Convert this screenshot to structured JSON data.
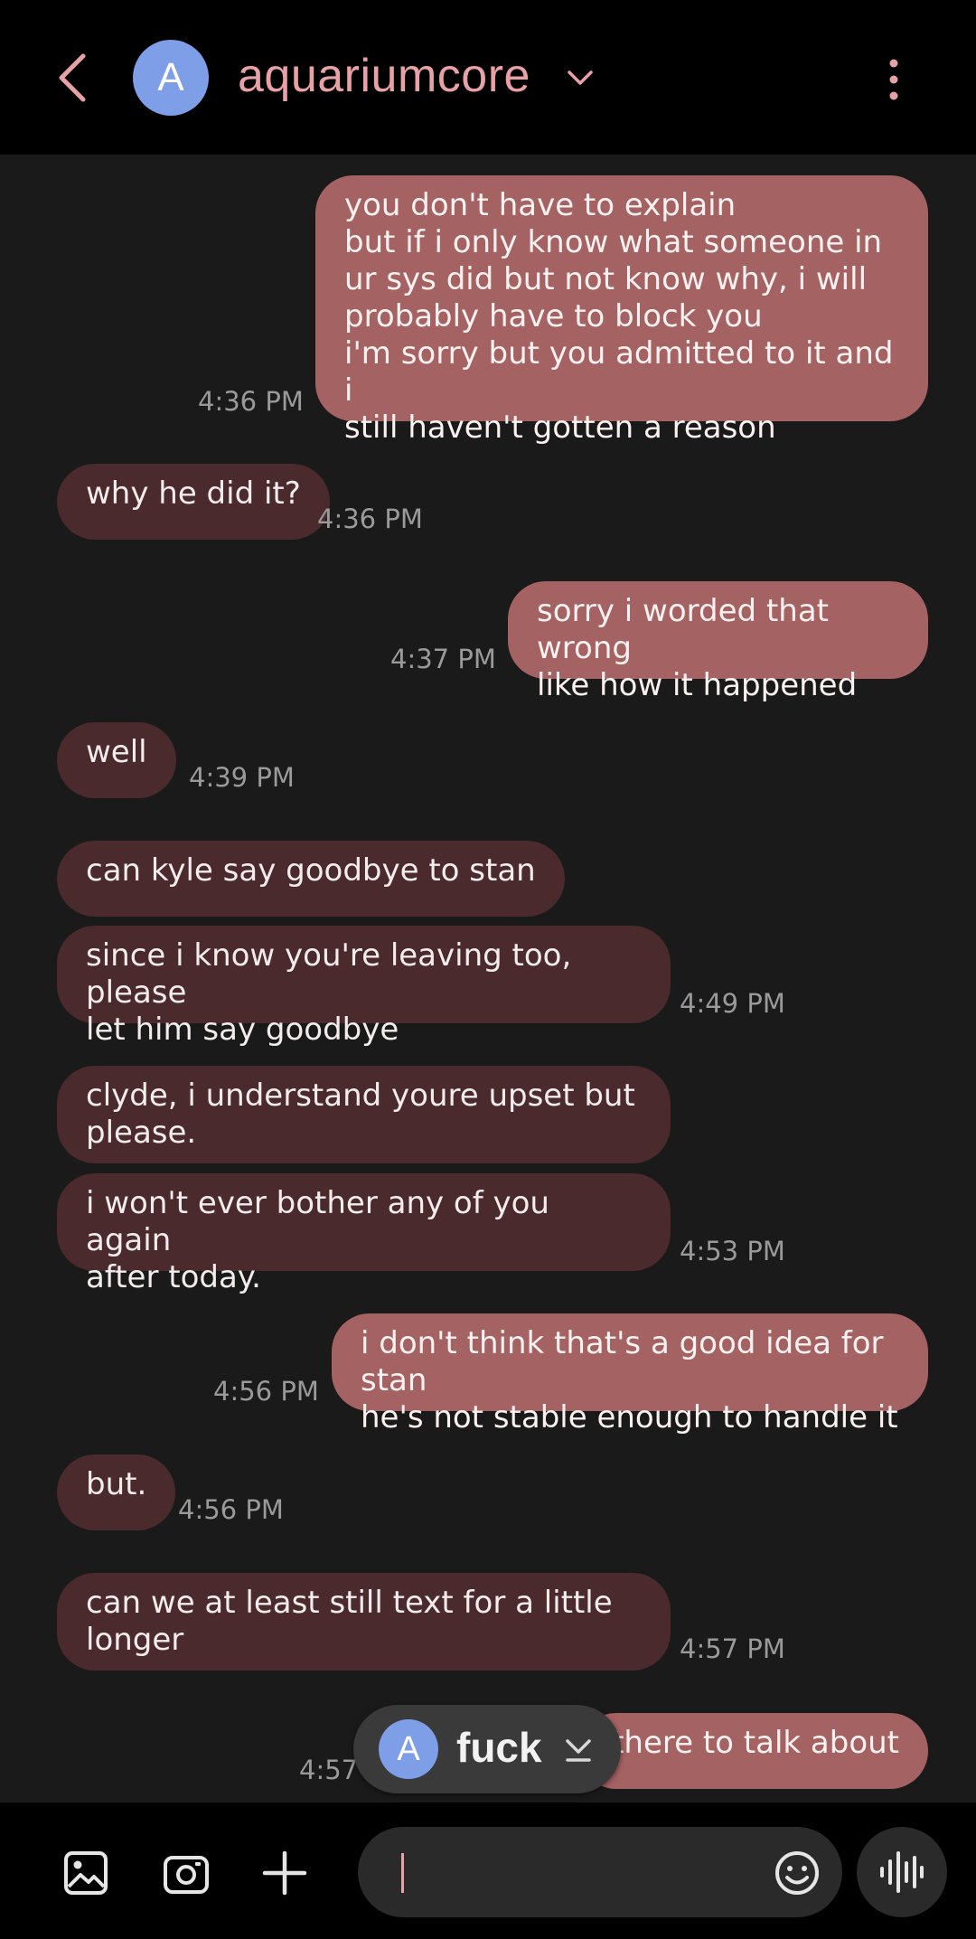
{
  "header": {
    "avatar_letter": "A",
    "contact_name": "aquariumcore"
  },
  "messages": [
    {
      "dir": "sent",
      "text": "you don't have to explain\nbut if i only know what someone in\nur sys did but not know why, i will\nprobably have to block you\ni'm sorry but you admitted to it and i\nstill haven't gotten a reason",
      "time": "4:36 PM"
    },
    {
      "dir": "recv",
      "text": "why he did it?",
      "time": "4:36 PM"
    },
    {
      "dir": "sent",
      "text": "sorry i worded that wrong\nlike how it happened",
      "time": "4:37 PM"
    },
    {
      "dir": "recv",
      "text": "well",
      "time": "4:39 PM"
    },
    {
      "dir": "recv",
      "text": "can kyle say goodbye to stan",
      "time": ""
    },
    {
      "dir": "recv",
      "text": "since i know you're leaving too, please\nlet him say goodbye",
      "time": "4:49 PM"
    },
    {
      "dir": "recv",
      "text": "clyde, i understand youre upset but\nplease.",
      "time": ""
    },
    {
      "dir": "recv",
      "text": "i won't ever bother any of you again\nafter today.",
      "time": "4:53 PM"
    },
    {
      "dir": "sent",
      "text": "i don't think that's a good idea for stan\nhe's not stable enough to handle it",
      "time": "4:56 PM"
    },
    {
      "dir": "recv",
      "text": "but.",
      "time": "4:56 PM"
    },
    {
      "dir": "recv",
      "text": "can we at least still text for a little\nlonger",
      "time": "4:57 PM"
    },
    {
      "dir": "sent",
      "text": "there to talk about",
      "time": "4:57"
    }
  ],
  "floating_chip": {
    "avatar_letter": "A",
    "label": "fuck"
  },
  "composer": {
    "value": ""
  },
  "colors": {
    "sent_bubble": "#a56263",
    "recv_bubble": "#4a2a2d",
    "accent": "#e8a1a5",
    "avatar": "#7f9ee8"
  },
  "icons": [
    "back-arrow-icon",
    "chevron-down-icon",
    "more-vert-icon",
    "gallery-icon",
    "camera-icon",
    "plus-icon",
    "emoji-icon",
    "voice-wave-icon"
  ]
}
